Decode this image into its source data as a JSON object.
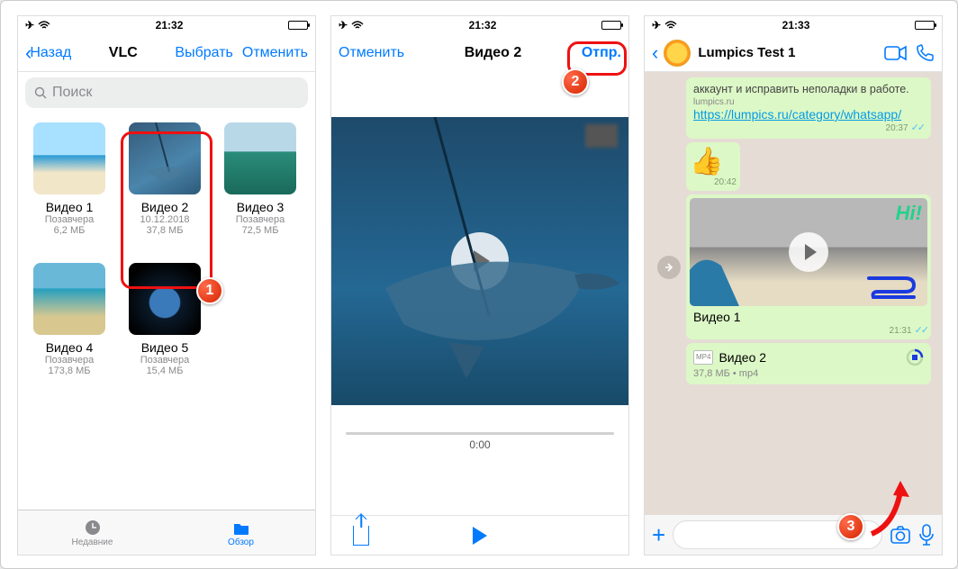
{
  "p1": {
    "status_time": "21:32",
    "back": "Назад",
    "title": "VLC",
    "select": "Выбрать",
    "cancel": "Отменить",
    "search_placeholder": "Поиск",
    "tiles": [
      {
        "name": "Видео 1",
        "date": "Позавчера",
        "size": "6,2 МБ"
      },
      {
        "name": "Видео 2",
        "date": "10.12.2018",
        "size": "37,8 МБ"
      },
      {
        "name": "Видео 3",
        "date": "Позавчера",
        "size": "72,5 МБ"
      },
      {
        "name": "Видео 4",
        "date": "Позавчера",
        "size": "173,8 МБ"
      },
      {
        "name": "Видео 5",
        "date": "Позавчера",
        "size": "15,4 МБ"
      }
    ],
    "tab_recent": "Недавние",
    "tab_browse": "Обзор",
    "step": "1"
  },
  "p2": {
    "status_time": "21:32",
    "cancel": "Отменить",
    "title": "Видео 2",
    "send": "Отпр.",
    "time": "0:00",
    "step": "2"
  },
  "p3": {
    "status_time": "21:33",
    "contact": "Lumpics Test 1",
    "msg_tail": "аккаунт и исправить неполадки в работе.",
    "msg_domain": "lumpics.ru",
    "msg_link": "https://lumpics.ru/category/whatsapp/",
    "msg_link_time": "20:37",
    "thumb_time": "20:42",
    "vid_hi": "Hi!",
    "video1_caption": "Видео 1",
    "video1_time": "21:31",
    "video2_name": "Видео 2",
    "video2_meta": "37,8 МБ • mp4",
    "step": "3"
  }
}
